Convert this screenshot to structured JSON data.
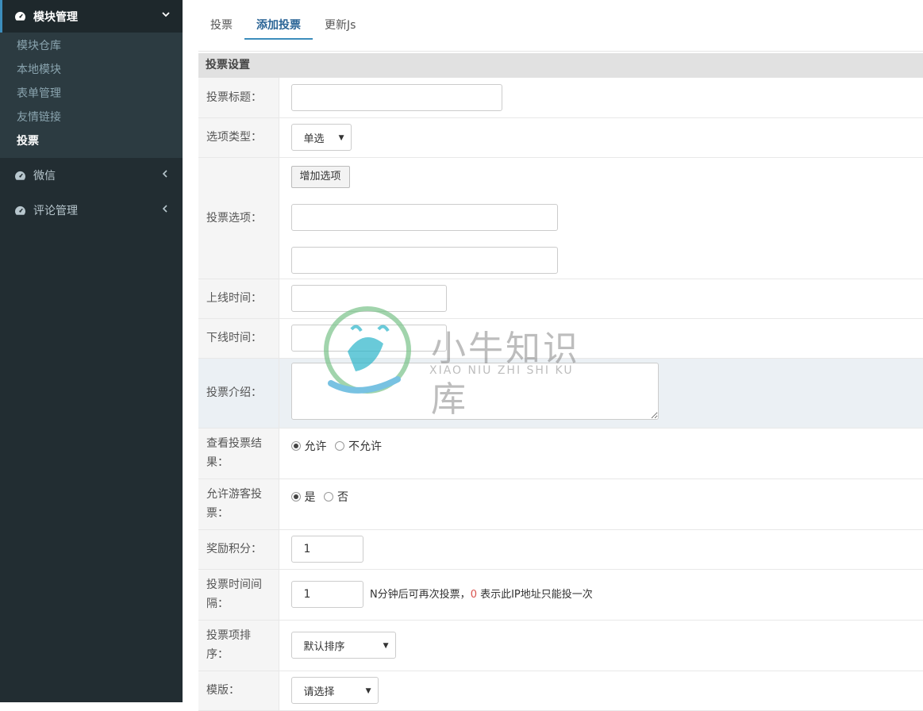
{
  "sidebar": {
    "module_mgmt": {
      "label": "模块管理",
      "icon": "dashboard-icon"
    },
    "sub_items": [
      {
        "label": "模块仓库"
      },
      {
        "label": "本地模块"
      },
      {
        "label": "表单管理"
      },
      {
        "label": "友情链接"
      },
      {
        "label": "投票"
      }
    ],
    "wechat": {
      "label": "微信"
    },
    "comments": {
      "label": "评论管理"
    }
  },
  "tabs": [
    {
      "label": "投票"
    },
    {
      "label": "添加投票"
    },
    {
      "label": "更新Js"
    }
  ],
  "panel_title": "投票设置",
  "form": {
    "title_label": "投票标题：",
    "type_label": "选项类型：",
    "type_value": "单选",
    "options_label": "投票选项：",
    "add_option_button": "增加选项",
    "online_label": "上线时间：",
    "offline_label": "下线时间：",
    "intro_label": "投票介绍：",
    "view_result_label": "查看投票结果：",
    "view_result_allow": "允许",
    "view_result_deny": "不允许",
    "guest_label": "允许游客投票：",
    "guest_yes": "是",
    "guest_no": "否",
    "reward_label": "奖励积分：",
    "reward_value": "1",
    "interval_label": "投票时间间隔：",
    "interval_value": "1",
    "interval_hint_prefix": "N分钟后可再次投票，",
    "interval_hint_zero": "0",
    "interval_hint_suffix": " 表示此IP地址只能投一次",
    "sort_label": "投票项排序：",
    "sort_value": "默认排序",
    "template_label": "模版：",
    "template_value": "请选择"
  },
  "watermark": {
    "title": "小牛知识库",
    "subtitle": "XIAO NIU ZHI SHI KU"
  },
  "colors": {
    "sidebar_bg": "#222d32",
    "submenu_bg": "#2c3b41",
    "accent": "#3c8dbc"
  }
}
